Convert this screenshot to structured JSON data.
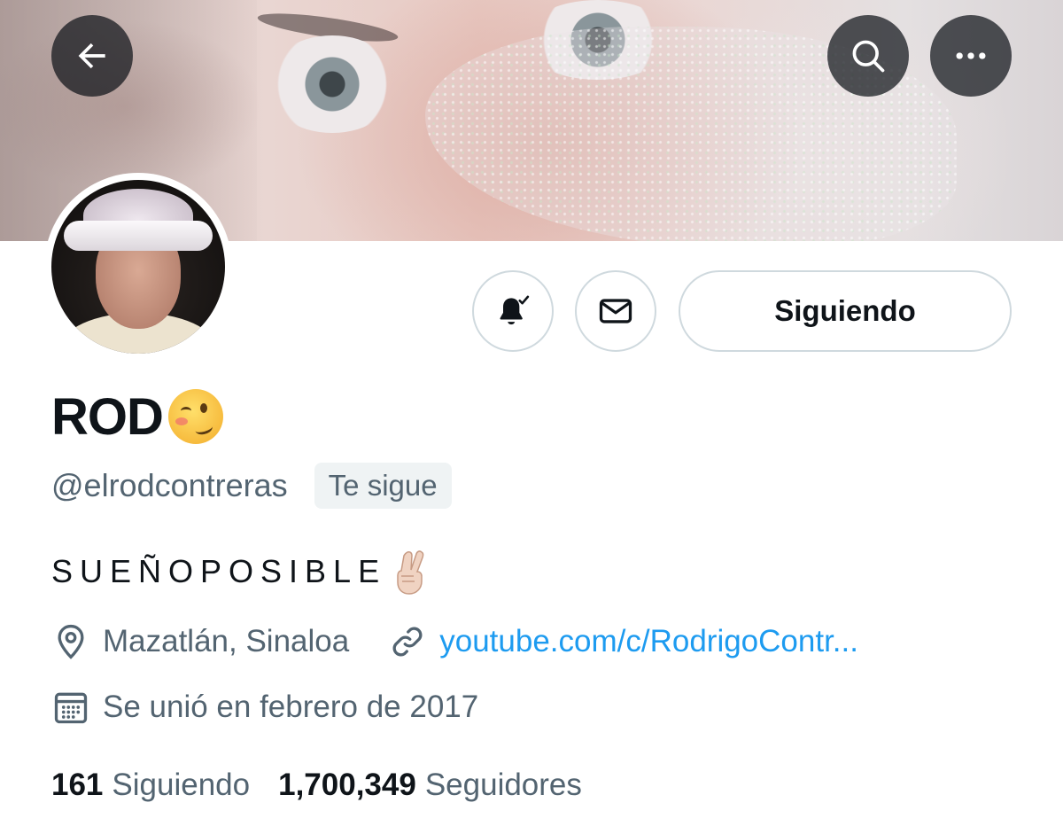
{
  "header": {
    "back_icon": "arrow-left-icon",
    "search_icon": "search-icon",
    "more_icon": "more-horizontal-icon"
  },
  "profile": {
    "display_name": "ROD",
    "name_emoji": "woozy-face-emoji",
    "handle": "@elrodcontreras",
    "follows_you_badge": "Te sigue",
    "bio": "SUEÑOPOSIBLE",
    "bio_emoji": "crossed-fingers-emoji",
    "location": "Mazatlán, Sinaloa",
    "website": "youtube.com/c/RodrigoContr...",
    "joined": "Se unió en febrero de 2017"
  },
  "actions": {
    "notify_icon": "bell-check-icon",
    "message_icon": "envelope-icon",
    "following_label": "Siguiendo"
  },
  "stats": {
    "following_count": "161",
    "following_label": "Siguiendo",
    "followers_count": "1,700,349",
    "followers_label": "Seguidores"
  },
  "colors": {
    "text_primary": "#0f1419",
    "text_secondary": "#536471",
    "link": "#1d9bf0",
    "border": "#cfd9de",
    "badge_bg": "#eff3f4"
  }
}
